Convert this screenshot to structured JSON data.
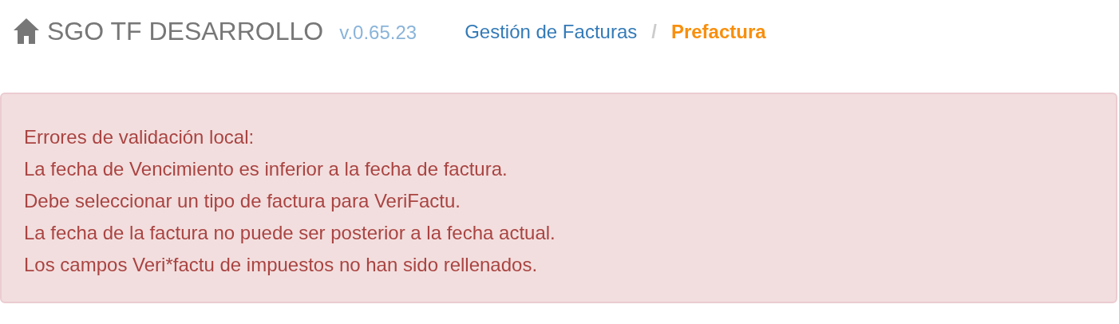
{
  "header": {
    "title": "SGO TF DESARROLLO",
    "version": "v.0.65.23"
  },
  "breadcrumb": {
    "separator": "/",
    "items": [
      {
        "label": "Gestión de Facturas",
        "selected": false
      },
      {
        "label": "Prefactura",
        "selected": true
      }
    ]
  },
  "alert": {
    "kind": "danger",
    "lines": [
      "Errores de validación local:",
      "La fecha de Vencimiento es inferior a la fecha de factura.",
      "Debe seleccionar un tipo de factura para VeriFactu.",
      "La fecha de la factura no puede ser posterior a la fecha actual.",
      "Los campos Veri*factu de impuestos no han sido rellenados."
    ]
  }
}
